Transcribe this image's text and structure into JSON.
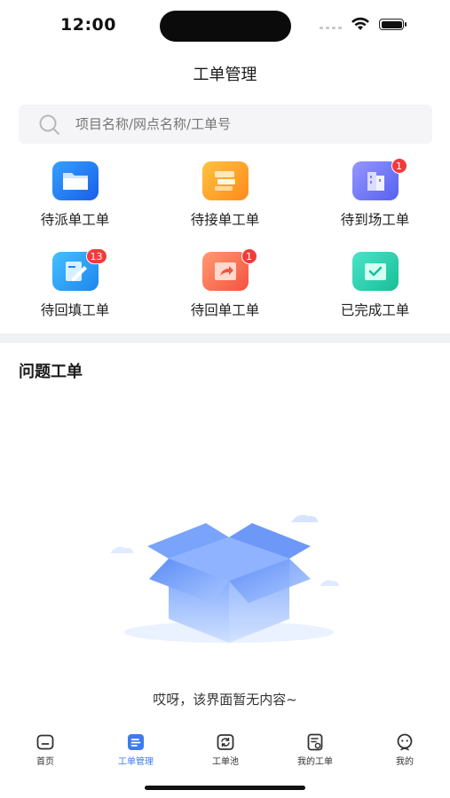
{
  "status_bar": {
    "time": "12:00"
  },
  "page": {
    "title": "工单管理"
  },
  "search": {
    "placeholder": "项目名称/网点名称/工单号"
  },
  "categories": [
    {
      "label": "待派单工单",
      "icon": "folder-icon",
      "badge": "",
      "colors": [
        "#2f86f8",
        "#1b5fe6"
      ]
    },
    {
      "label": "待接单工单",
      "icon": "document-stack-icon",
      "badge": "",
      "colors": [
        "#ffb93a",
        "#ff8f1f"
      ]
    },
    {
      "label": "待到场工单",
      "icon": "building-icon",
      "badge": "1",
      "colors": [
        "#8a8cff",
        "#5a63f2"
      ]
    },
    {
      "label": "待回填工单",
      "icon": "edit-form-icon",
      "badge": "13",
      "colors": [
        "#3bb8ff",
        "#1b8df2"
      ]
    },
    {
      "label": "待回单工单",
      "icon": "share-return-icon",
      "badge": "1",
      "colors": [
        "#ff8f6b",
        "#f5584a"
      ]
    },
    {
      "label": "已完成工单",
      "icon": "check-folder-icon",
      "badge": "",
      "colors": [
        "#3fe0c3",
        "#1cc39b"
      ]
    }
  ],
  "section": {
    "title": "问题工单"
  },
  "empty_state": {
    "text": "哎呀，该界面暂无内容~",
    "icon": "empty-box-illustration"
  },
  "tabs": [
    {
      "label": "首页",
      "icon": "home-icon",
      "active": false
    },
    {
      "label": "工单管理",
      "icon": "workorder-manage-icon",
      "active": true
    },
    {
      "label": "工单池",
      "icon": "workorder-pool-icon",
      "active": false
    },
    {
      "label": "我的工单",
      "icon": "my-workorder-icon",
      "active": false
    },
    {
      "label": "我的",
      "icon": "profile-icon",
      "active": false
    }
  ],
  "colors": {
    "accent": "#3d7bf0",
    "badge": "#f23b3b",
    "divider": "#f0f1f3"
  }
}
